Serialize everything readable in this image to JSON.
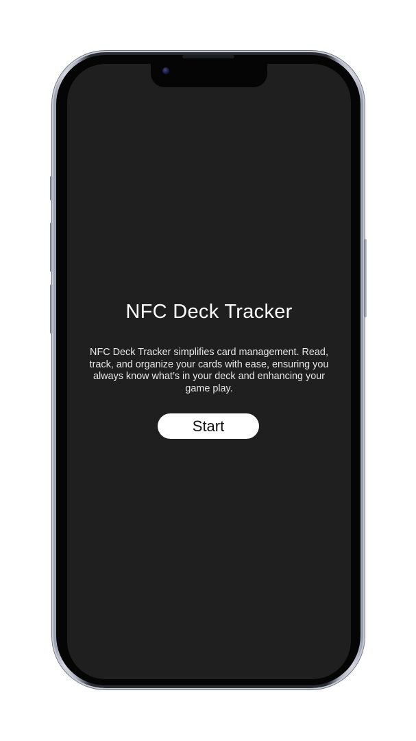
{
  "app": {
    "title": "NFC Deck Tracker",
    "description": "NFC Deck Tracker simplifies card management. Read, track, and organize your cards with ease, ensuring you always know what’s in your deck and enhancing your game play.",
    "start_button_label": "Start"
  },
  "colors": {
    "screen_background": "#1f1f1f",
    "text_primary": "#ffffff",
    "button_background": "#ffffff",
    "button_text": "#111111"
  }
}
